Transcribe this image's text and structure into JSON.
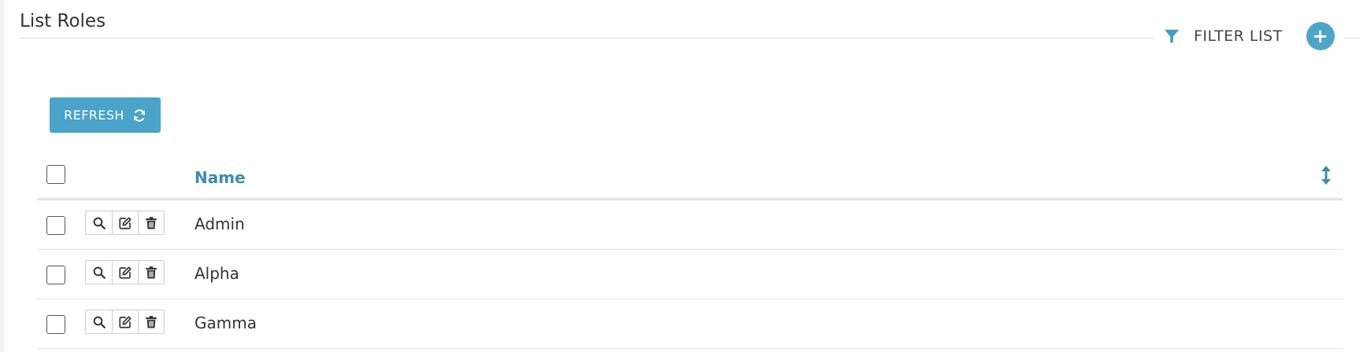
{
  "page": {
    "title": "List Roles"
  },
  "header": {
    "filter_label": "FILTER LIST",
    "add_label": "+"
  },
  "toolbar": {
    "refresh_label": "REFRESH"
  },
  "table": {
    "columns": [
      "Name"
    ],
    "rows": [
      {
        "name": "Admin"
      },
      {
        "name": "Alpha"
      },
      {
        "name": "Gamma"
      }
    ]
  },
  "icons": {
    "filter": "filter-icon",
    "add": "plus-icon",
    "refresh": "refresh-icon",
    "sort": "sort-icon",
    "view": "search-icon",
    "edit": "edit-icon",
    "delete": "trash-icon"
  },
  "colors": {
    "accent": "#4aa3c8",
    "header_text": "#3b8db0",
    "text": "#333333"
  }
}
